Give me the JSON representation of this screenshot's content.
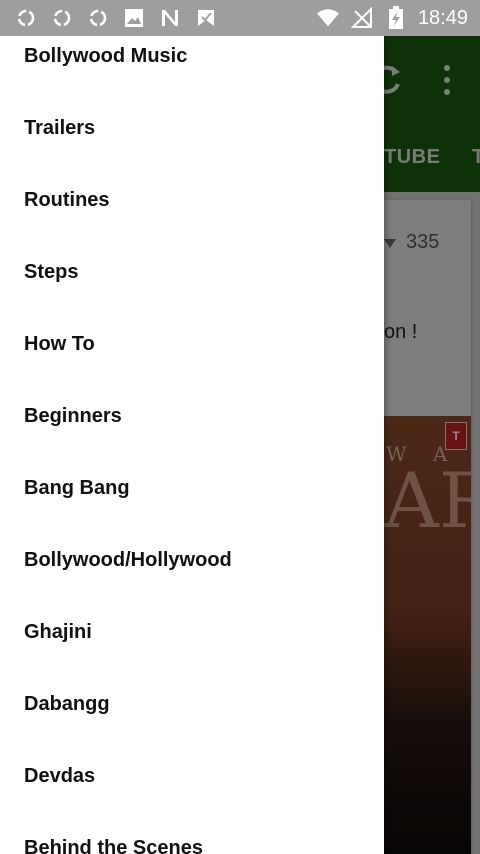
{
  "status_bar": {
    "time": "18:49",
    "icons": [
      "sync-icon",
      "sync-icon",
      "sync-icon",
      "image-icon",
      "n-icon",
      "check-icon",
      "wifi-icon",
      "no-signal-icon",
      "battery-charging-icon"
    ]
  },
  "background": {
    "toolbar_color": "#1a5b10",
    "tab_label": "TUBE",
    "tab_label_2": "T",
    "card": {
      "views": "335",
      "text": "on !"
    }
  },
  "drawer": {
    "items": [
      {
        "label": "Bollywood Music"
      },
      {
        "label": "Trailers"
      },
      {
        "label": "Routines"
      },
      {
        "label": "Steps"
      },
      {
        "label": "How To"
      },
      {
        "label": "Beginners"
      },
      {
        "label": "Bang Bang"
      },
      {
        "label": "Bollywood/Hollywood"
      },
      {
        "label": "Ghajini"
      },
      {
        "label": "Dabangg"
      },
      {
        "label": "Devdas"
      },
      {
        "label": "Behind the Scenes"
      }
    ]
  }
}
